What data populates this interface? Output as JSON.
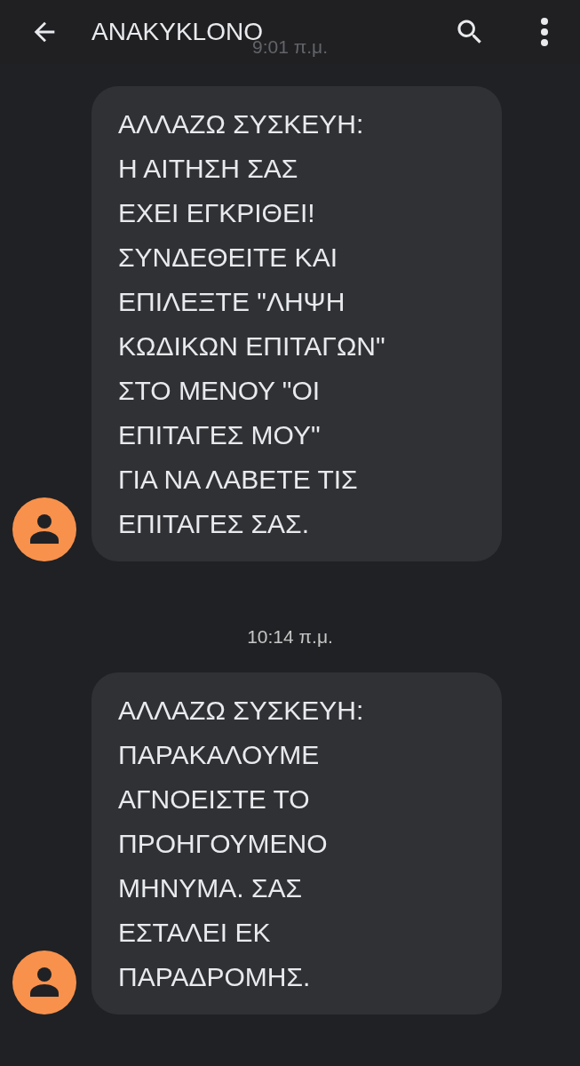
{
  "header": {
    "title": "ANAKYKLONO"
  },
  "thread": [
    {
      "kind": "timestamp",
      "text": "9:01 π.μ.",
      "faded": true
    },
    {
      "kind": "message",
      "text": "ΑΛΛΑΖΩ ΣΥΣΚΕΥΗ:\nΗ ΑΙΤΗΣΗ ΣΑΣ\nΕΧΕΙ ΕΓΚΡΙΘΕΙ!\nΣΥΝΔΕΘΕΙΤΕ ΚΑΙ\nΕΠΙΛΕΞΤΕ \"ΛΗΨΗ\nΚΩΔΙΚΩΝ ΕΠΙΤΑΓΩΝ\"\nΣΤΟ ΜΕΝΟΥ \"ΟΙ\nΕΠΙΤΑΓΕΣ ΜΟΥ\"\nΓΙΑ ΝΑ ΛΑΒΕΤΕ ΤΙΣ\nΕΠΙΤΑΓΕΣ ΣΑΣ."
    },
    {
      "kind": "timestamp",
      "text": "10:14 π.μ.",
      "faded": false
    },
    {
      "kind": "message",
      "text": "ΑΛΛΑΖΩ ΣΥΣΚΕΥΗ:\nΠΑΡΑΚΑΛΟΥΜΕ\nΑΓΝΟΕΙΣΤΕ ΤΟ\nΠΡΟΗΓΟΥΜΕΝΟ\nΜΗΝΥΜΑ. ΣΑΣ\nΕΣΤΑΛΕΙ ΕΚ\nΠΑΡΑΔΡΟΜΗΣ."
    }
  ]
}
